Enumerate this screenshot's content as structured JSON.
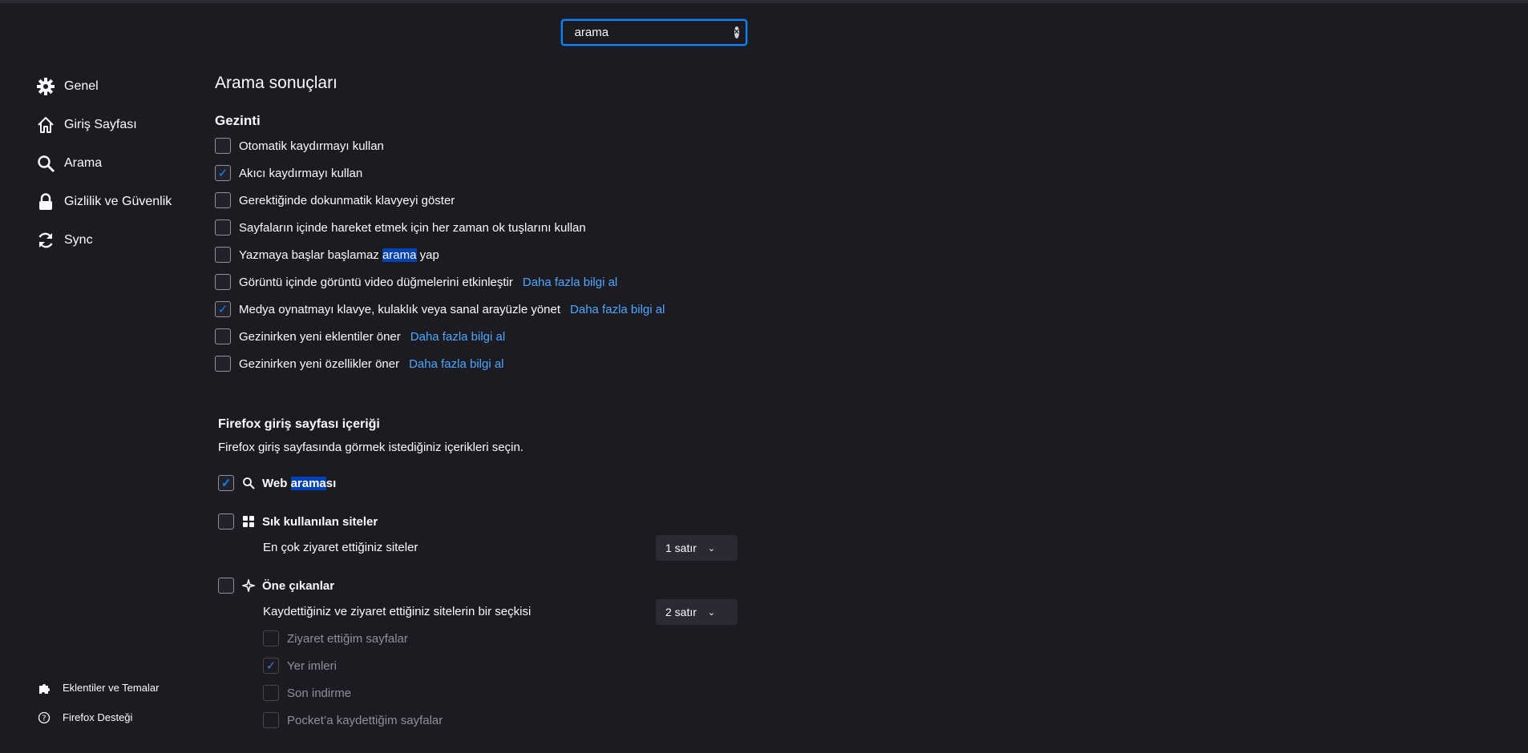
{
  "search": {
    "value": "arama"
  },
  "sidebar": {
    "items": [
      {
        "label": "Genel",
        "icon": "gear-icon"
      },
      {
        "label": "Giriş Sayfası",
        "icon": "home-icon"
      },
      {
        "label": "Arama",
        "icon": "search-icon"
      },
      {
        "label": "Gizlilik ve Güvenlik",
        "icon": "lock-icon"
      },
      {
        "label": "Sync",
        "icon": "sync-icon"
      }
    ],
    "bottom": [
      {
        "label": "Eklentiler ve Temalar",
        "icon": "puzzle-icon"
      },
      {
        "label": "Firefox Desteği",
        "icon": "help-icon"
      }
    ]
  },
  "main": {
    "title": "Arama sonuçları",
    "browsing": {
      "title": "Gezinti",
      "options": [
        {
          "label": "Otomatik kaydırmayı kullan",
          "checked": false
        },
        {
          "label": "Akıcı kaydırmayı kullan",
          "checked": true
        },
        {
          "label": "Gerektiğinde dokunmatik klavyeyi göster",
          "checked": false
        },
        {
          "label": "Sayfaların içinde hareket etmek için her zaman ok tuşlarını kullan",
          "checked": false
        },
        {
          "label_before": "Yazmaya başlar başlamaz ",
          "label_highlight": "arama",
          "label_after": " yap",
          "checked": false
        },
        {
          "label": "Görüntü içinde görüntü video düğmelerini etkinleştir",
          "link": "Daha fazla bilgi al",
          "checked": false
        },
        {
          "label": "Medya oynatmayı klavye, kulaklık veya sanal arayüzle yönet",
          "link": "Daha fazla bilgi al",
          "checked": true
        },
        {
          "label": "Gezinirken yeni eklentiler öner",
          "link": "Daha fazla bilgi al",
          "checked": false
        },
        {
          "label": "Gezinirken yeni özellikler öner",
          "link": "Daha fazla bilgi al",
          "checked": false
        }
      ]
    },
    "home": {
      "title": "Firefox giriş sayfası içeriği",
      "description": "Firefox giriş sayfasında görmek istediğiniz içerikleri seçin.",
      "web_search": {
        "before": "Web ",
        "highlight": "arama",
        "after": "sı",
        "checked": true
      },
      "top_sites": {
        "label": "Sık kullanılan siteler",
        "checked": false,
        "desc": "En çok ziyaret ettiğiniz siteler",
        "select": "1 satır"
      },
      "highlights": {
        "label": "Öne çıkanlar",
        "checked": false,
        "desc": "Kaydettiğiniz ve ziyaret ettiğiniz sitelerin bir seçkisi",
        "select": "2 satır",
        "sub": [
          {
            "label": "Ziyaret ettiğim sayfalar",
            "checked": false
          },
          {
            "label": "Yer imleri",
            "checked": true
          },
          {
            "label": "Son indirme",
            "checked": false
          },
          {
            "label": "Pocket’a kaydettiğim sayfalar",
            "checked": false
          }
        ]
      }
    }
  },
  "colors": {
    "background": "#1c1b22",
    "accent": "#0a84ff",
    "link": "#4ca7ff",
    "highlight": "#0042b3"
  }
}
